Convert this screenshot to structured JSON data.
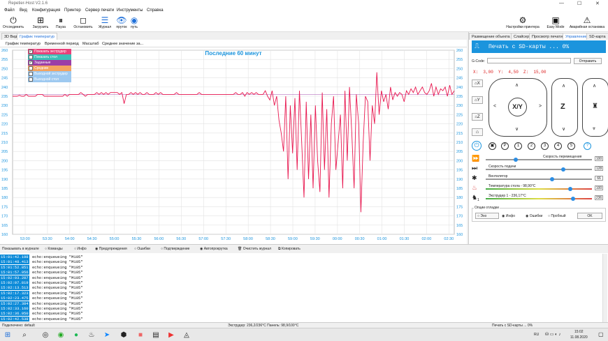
{
  "window": {
    "title": "Repetier-Host V2.1.6"
  },
  "menu": [
    "Файл",
    "Вид",
    "Конфигурация",
    "Принтер",
    "Сервер печати",
    "Инструменты",
    "Справка"
  ],
  "toolbar": {
    "disconnect": "Отсоединить",
    "load": "Загрузить",
    "pause": "Пауза",
    "stop": "Остановить",
    "log": "Журнал",
    "filament": "пруток",
    "path": "путь",
    "printer_settings": "Настройки принтера",
    "easy_mode": "Easy Mode",
    "emergency": "Аварийная остановка"
  },
  "left_tabs": [
    "3D Вид",
    "График температур"
  ],
  "chart_menu": [
    "График температур",
    "Временной период",
    "Масштаб",
    "Среднее значение за..."
  ],
  "right_tabs": [
    "Размещение объекта",
    "Слайсер",
    "Просмотр печати",
    "Управление",
    "SD-карта"
  ],
  "legend": [
    {
      "label": "Показать экструдер",
      "checked": true,
      "color": "#e8417a"
    },
    {
      "label": "Показать стол",
      "checked": false,
      "color": "#3bbfb7"
    },
    {
      "label": "Заданные",
      "checked": true,
      "color": "#9b3ea7"
    },
    {
      "label": "Средние",
      "checked": false,
      "color": "#f4a460"
    },
    {
      "label": "Выходной экструдер",
      "checked": false,
      "color": "#9ec9f0"
    },
    {
      "label": "Выходной стол",
      "checked": false,
      "color": "#9ec9f0"
    }
  ],
  "chart_data": {
    "type": "line",
    "title": "Последние 60 минут",
    "x": [
      "53:00",
      "53:30",
      "54:00",
      "54:30",
      "55:00",
      "55:30",
      "56:00",
      "56:30",
      "57:00",
      "57:30",
      "58:00",
      "58:30",
      "59:00",
      "59:30",
      "00:00",
      "00:30",
      "01:00",
      "01:30",
      "02:00",
      "02:30"
    ],
    "ylim": [
      160,
      260
    ],
    "yticks": [
      160,
      165,
      170,
      175,
      180,
      185,
      190,
      195,
      200,
      205,
      210,
      215,
      220,
      225,
      230,
      235,
      240,
      245,
      250,
      255,
      260
    ],
    "series": [
      {
        "name": "Показать экструдер",
        "color": "#e8174f",
        "values": [
          235,
          235,
          235,
          235.5,
          235,
          235,
          236,
          235,
          235,
          235,
          235,
          236,
          236,
          236,
          235,
          235,
          235,
          235,
          235,
          235,
          235,
          235,
          235,
          236,
          235,
          236,
          236,
          236,
          236,
          236,
          237,
          236,
          235,
          236,
          236,
          236,
          236,
          237,
          236,
          237,
          236,
          237,
          236,
          237,
          237,
          237,
          237,
          236,
          237,
          231,
          236,
          236,
          237,
          236,
          237,
          236,
          237,
          236,
          236,
          237,
          236,
          236,
          236,
          237,
          236,
          237,
          236,
          236,
          236,
          236,
          236,
          236,
          237,
          236,
          236,
          236,
          236,
          236,
          236,
          236,
          236,
          236,
          237,
          236,
          236,
          236,
          236,
          236,
          236,
          236,
          236,
          236,
          236,
          236,
          236,
          236,
          236,
          236,
          237,
          236,
          236,
          237,
          235,
          237,
          236,
          237,
          236,
          237,
          236,
          236,
          236,
          238,
          235,
          233,
          238,
          230,
          235,
          222,
          215,
          205,
          235,
          190,
          230,
          204,
          234,
          195,
          238,
          210,
          180,
          232,
          190,
          225,
          185,
          230,
          200,
          183,
          237,
          195,
          228,
          180,
          220,
          235,
          195,
          210,
          225,
          185,
          238,
          200,
          240,
          215,
          185,
          236,
          220,
          172,
          210,
          235,
          232,
          200,
          230,
          220,
          248,
          225,
          238,
          232,
          236,
          228,
          240,
          233,
          237,
          235,
          237,
          236,
          232,
          238,
          236,
          239,
          237,
          240,
          236,
          238,
          240,
          237,
          236,
          238,
          242,
          235,
          240,
          236,
          239,
          238,
          240,
          235,
          241,
          236,
          238
        ]
      },
      {
        "name": "Заданные",
        "color": "#9b3ea7",
        "values": [
          236
        ]
      }
    ]
  },
  "control": {
    "title": "Печать с SD-карты ... 0%",
    "gcode_label": "G-Code:",
    "send": "Отправить",
    "x_label": "X:",
    "x_val": "3,00",
    "y_label": "Y:",
    "y_val": "4,50",
    "z_label": "Z:",
    "z_val": "15,00",
    "home_x": "X",
    "home_y": "Y",
    "home_z": "Z",
    "xy": "X/Y",
    "z": "Z",
    "presets": [
      "P",
      "1",
      "2",
      "3",
      "4",
      "5",
      "?"
    ],
    "speed_move": "Скорость перемещения",
    "speed_move_val": "100",
    "speed_feed": "Скорость подачи",
    "speed_feed_val": "128",
    "fan": "Вентилятор",
    "fan_val": "66",
    "bed_temp": "Температура стола - 98,90°C",
    "bed_val": "100",
    "extruder_temp": "Экструдер 1 - 236,17°C",
    "extruder_val": "236",
    "extruder_idx": "1",
    "debug": "Опции отладки",
    "echo": "Эхо",
    "info": "Инфо",
    "errors": "Ошибки",
    "dry": "Пробный",
    "ok": "OK"
  },
  "log_filter": {
    "show": "Показывать в журнале",
    "commands": "Команды",
    "info": "Инфо",
    "warnings": "Предупреждения",
    "errors": "Ошибки",
    "confirm": "Подтверждение",
    "autoscroll": "Автопрокрутка",
    "clear": "Очистить журнал",
    "copy": "Копировать"
  },
  "log": [
    {
      "ts": "15:01:42.198",
      "msg": "echo:enqueueing \"M105\""
    },
    {
      "ts": "15:01:48.413",
      "msg": "echo:enqueueing \"M105\""
    },
    {
      "ts": "15:01:52.851",
      "msg": "echo:enqueueing \"M105\""
    },
    {
      "ts": "15:01:57.056",
      "msg": "echo:enqueueing \"M105\""
    },
    {
      "ts": "15:02:03.287",
      "msg": "echo:enqueueing \"M105\""
    },
    {
      "ts": "15:02:07.819",
      "msg": "echo:enqueueing \"M105\""
    },
    {
      "ts": "15:02:13.513",
      "msg": "echo:enqueueing \"M105\""
    },
    {
      "ts": "15:02:17.323",
      "msg": "echo:enqueueing \"M105\""
    },
    {
      "ts": "15:02:23.475",
      "msg": "echo:enqueueing \"M105\""
    },
    {
      "ts": "15:02:27.384",
      "msg": "echo:enqueueing \"M105\""
    },
    {
      "ts": "15:02:33.160",
      "msg": "echo:enqueueing \"M105\""
    },
    {
      "ts": "15:02:36.950",
      "msg": "echo:enqueueing \"M105\""
    },
    {
      "ts": "15:02:42.538",
      "msg": "echo:enqueueing \"M105\""
    }
  ],
  "status": {
    "connection": "Подключено: default",
    "temps": "Экструдер: 236,2/236°C Панель: 98,9/100°C",
    "print": "Печать с SD-карты ... 0%"
  },
  "taskbar": {
    "lang": "RU",
    "time": "15:02",
    "date": "11.08.2020"
  }
}
